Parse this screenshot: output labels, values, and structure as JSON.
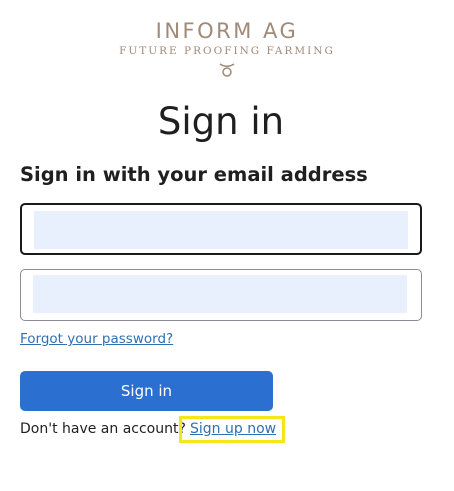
{
  "logo": {
    "name": "INFORM AG",
    "tagline": "FUTURE PROOFING FARMING",
    "mark_icon": "loop-ribbon-icon",
    "color": "#a08a78"
  },
  "page_title": "Sign in",
  "subtitle": "Sign in with your email address",
  "form": {
    "email_value": "",
    "password_value": "",
    "forgot_password_label": "Forgot your password?",
    "signin_label": "Sign in",
    "no_account_text": "Don't have an account?",
    "signup_label": "Sign up now"
  },
  "colors": {
    "accent": "#2b6fd0",
    "link": "#2f6fb3",
    "highlight": "#f5e61a",
    "autofill": "#e8f0fe"
  }
}
